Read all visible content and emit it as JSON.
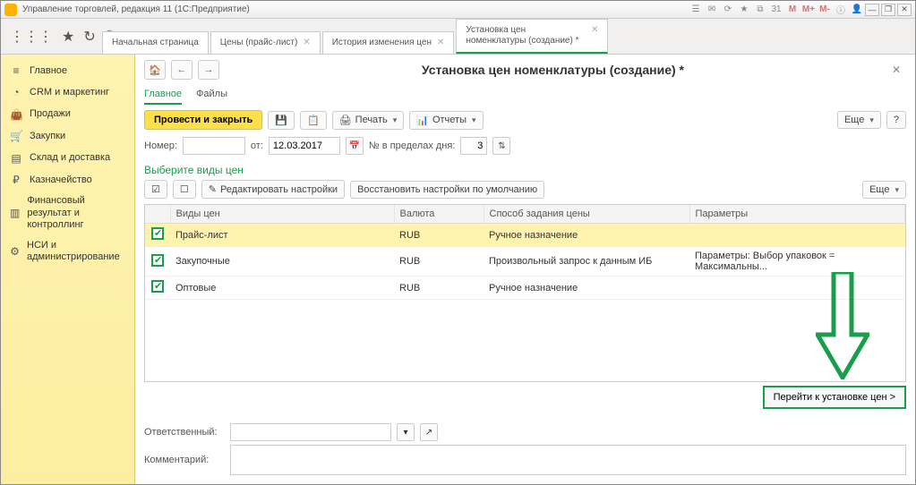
{
  "titlebar": {
    "text": "Управление торговлей, редакция 11  (1С:Предприятие)",
    "m_labels": [
      "M",
      "M+",
      "M-"
    ]
  },
  "tabs": [
    {
      "label": "Начальная страница",
      "closable": false
    },
    {
      "label": "Цены (прайс-лист)",
      "closable": true
    },
    {
      "label": "История изменения цен",
      "closable": true
    },
    {
      "label": "Установка цен номенклатуры (создание) *",
      "closable": true,
      "active": true
    }
  ],
  "sidebar": [
    {
      "icon": "≡",
      "label": "Главное",
      "name": "sidebar-main"
    },
    {
      "icon": "◔",
      "label": "CRM и маркетинг",
      "name": "sidebar-crm"
    },
    {
      "icon": "👜",
      "label": "Продажи",
      "name": "sidebar-sales"
    },
    {
      "icon": "🛒",
      "label": "Закупки",
      "name": "sidebar-purchases"
    },
    {
      "icon": "▤",
      "label": "Склад и доставка",
      "name": "sidebar-warehouse"
    },
    {
      "icon": "₽",
      "label": "Казначейство",
      "name": "sidebar-treasury"
    },
    {
      "icon": "▥",
      "label": "Финансовый результат и контроллинг",
      "name": "sidebar-fin"
    },
    {
      "icon": "⚙",
      "label": "НСИ и администрирование",
      "name": "sidebar-nsi"
    }
  ],
  "doc": {
    "title": "Установка цен номенклатуры (создание) *",
    "subtabs": {
      "main": "Главное",
      "files": "Файлы"
    },
    "toolbar": {
      "post_close": "Провести и закрыть",
      "print": "Печать",
      "reports": "Отчеты",
      "more": "Еще",
      "help": "?"
    },
    "fields": {
      "number_label": "Номер:",
      "number_value": "",
      "date_label": "от:",
      "date_value": "12.03.2017",
      "within_day_label": "№ в пределах дня:",
      "within_day_value": "3"
    },
    "section_title": "Выберите виды цен",
    "toolbar2": {
      "edit_settings": "Редактировать настройки",
      "restore_defaults": "Восстановить настройки по умолчанию",
      "more": "Еще"
    },
    "grid": {
      "headers": {
        "col0": "",
        "col1": "Виды цен",
        "col2": "Валюта",
        "col3": "Способ задания цены",
        "col4": "Параметры"
      },
      "rows": [
        {
          "checked": true,
          "selected": true,
          "name": "Прайс-лист",
          "currency": "RUB",
          "method": "Ручное назначение",
          "params": ""
        },
        {
          "checked": true,
          "name": "Закупочные",
          "currency": "RUB",
          "method": "Произвольный запрос к данным ИБ",
          "params": "Параметры: Выбор упаковок = Максимальны..."
        },
        {
          "checked": true,
          "name": "Оптовые",
          "currency": "RUB",
          "method": "Ручное назначение",
          "params": ""
        }
      ]
    },
    "go_button": "Перейти к установке цен >",
    "responsible_label": "Ответственный:",
    "responsible_value": "",
    "comment_label": "Комментарий:",
    "comment_value": ""
  }
}
